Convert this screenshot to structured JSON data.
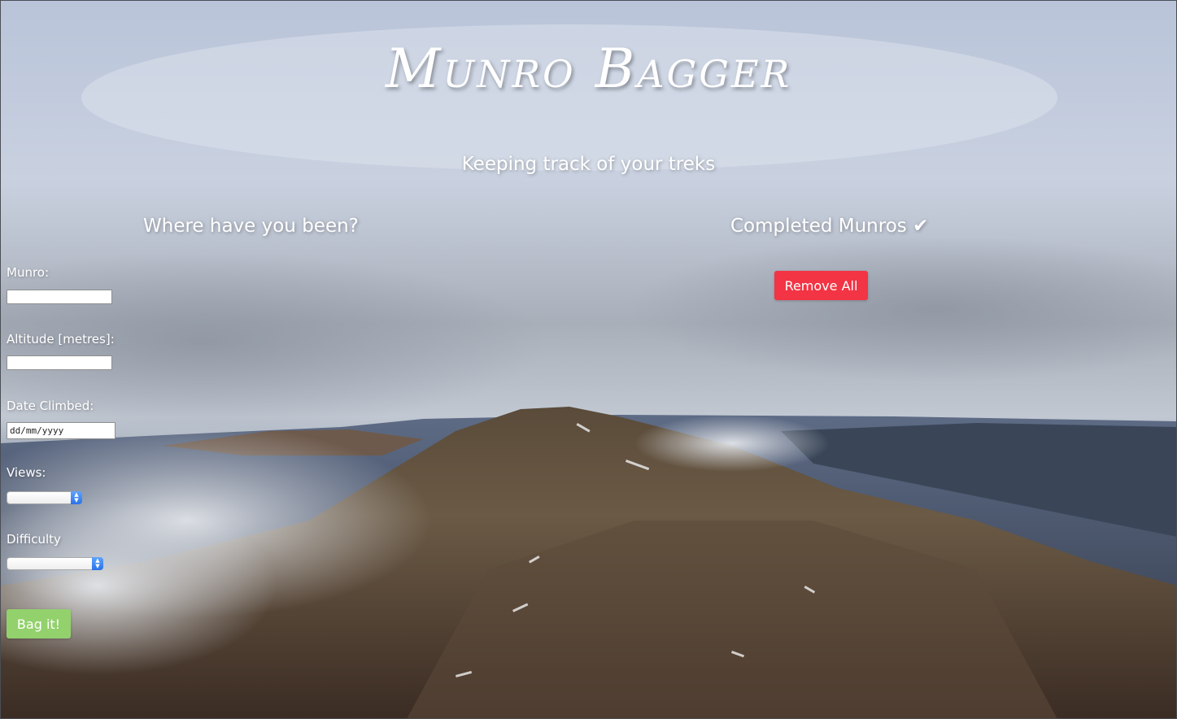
{
  "header": {
    "title": "Munro Bagger",
    "tagline": "Keeping track of your treks"
  },
  "form": {
    "heading": "Where have you been?",
    "munro_label": "Munro:",
    "munro_value": "",
    "altitude_label": "Altitude [metres]:",
    "altitude_value": "",
    "date_label": "Date Climbed:",
    "date_placeholder": "dd/mm/yyyy",
    "views_label": "Views:",
    "views_value": "",
    "difficulty_label": "Difficulty",
    "difficulty_value": "",
    "submit_label": "Bag it!"
  },
  "completed": {
    "heading": "Completed Munros ✔",
    "remove_all_label": "Remove All",
    "items": []
  },
  "colors": {
    "submit_button": "#93d16d",
    "remove_button": "#f23444",
    "text": "#ffffff"
  }
}
